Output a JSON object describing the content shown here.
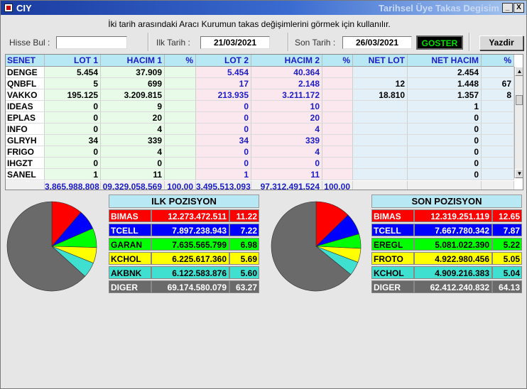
{
  "titlebar": {
    "title": "CIY",
    "subtitle": "Tarihsel Üye Takas Degisim",
    "min_label": "_",
    "close_label": "X"
  },
  "hint": "İki tarih arasındaki  Aracı Kurumun takas değişimlerini görmek için kullanılır.",
  "search": {
    "label": "Hisse Bul :",
    "value": ""
  },
  "first_date": {
    "label": "Ilk Tarih :",
    "value": "21/03/2021"
  },
  "last_date": {
    "label": "Son Tarih :",
    "value": "26/03/2021"
  },
  "buttons": {
    "show": "GOSTER",
    "print": "Yazdir"
  },
  "table": {
    "headers": [
      "SENET",
      "LOT 1",
      "HACIM 1",
      "%",
      "LOT 2",
      "HACIM 2",
      "%",
      "NET LOT",
      "NET HACIM",
      "%"
    ],
    "rows": [
      [
        "DENGE",
        "5.454",
        "37.909",
        "",
        "5.454",
        "40.364",
        "",
        "",
        "2.454",
        ""
      ],
      [
        "QNBFL",
        "5",
        "699",
        "",
        "17",
        "2.148",
        "",
        "12",
        "1.448",
        "67"
      ],
      [
        "VAKKO",
        "195.125",
        "3.209.815",
        "",
        "213.935",
        "3.211.172",
        "",
        "18.810",
        "1.357",
        "8"
      ],
      [
        "IDEAS",
        "0",
        "9",
        "",
        "0",
        "10",
        "",
        "",
        "1",
        ""
      ],
      [
        "EPLAS",
        "0",
        "20",
        "",
        "0",
        "20",
        "",
        "",
        "0",
        ""
      ],
      [
        "INFO",
        "0",
        "4",
        "",
        "0",
        "4",
        "",
        "",
        "0",
        ""
      ],
      [
        "GLRYH",
        "34",
        "339",
        "",
        "34",
        "339",
        "",
        "",
        "0",
        ""
      ],
      [
        "FRIGO",
        "0",
        "4",
        "",
        "0",
        "4",
        "",
        "",
        "0",
        ""
      ],
      [
        "IHGZT",
        "0",
        "0",
        "",
        "0",
        "0",
        "",
        "",
        "0",
        ""
      ],
      [
        "SANEL",
        "1",
        "11",
        "",
        "1",
        "11",
        "",
        "",
        "0",
        ""
      ]
    ],
    "totals": [
      "",
      "3.865.988.808",
      "09.329.058.569",
      "100,00",
      "3.495.513.093",
      "97.312.491.524",
      "100,00",
      "",
      "",
      ""
    ]
  },
  "colors": {
    "red": "#ff0000",
    "blue": "#0000ff",
    "green": "#00ff00",
    "yellow": "#ffff00",
    "cyan": "#40e0d0",
    "gray": "#6a6a6a"
  },
  "first_position": {
    "title": "ILK POZISYON",
    "rows": [
      {
        "name": "BIMAS",
        "value": "12.273.472.511",
        "pct": "11.22",
        "share": 11.22,
        "color": "#ff0000",
        "text": "#ffffff"
      },
      {
        "name": "TCELL",
        "value": "7.897.238.943",
        "pct": "7.22",
        "share": 7.22,
        "color": "#0000ff",
        "text": "#ffffff"
      },
      {
        "name": "GARAN",
        "value": "7.635.565.799",
        "pct": "6.98",
        "share": 6.98,
        "color": "#00ff00",
        "text": "#000000"
      },
      {
        "name": "KCHOL",
        "value": "6.225.617.360",
        "pct": "5.69",
        "share": 5.69,
        "color": "#ffff00",
        "text": "#000000"
      },
      {
        "name": "AKBNK",
        "value": "6.122.583.876",
        "pct": "5.60",
        "share": 5.6,
        "color": "#40e0d0",
        "text": "#000000"
      },
      {
        "name": "DIGER",
        "value": "69.174.580.079",
        "pct": "63.27",
        "share": 63.27,
        "color": "#6a6a6a",
        "text": "#ffffff"
      }
    ]
  },
  "last_position": {
    "title": "SON POZISYON",
    "rows": [
      {
        "name": "BIMAS",
        "value": "12.319.251.119",
        "pct": "12.65",
        "share": 12.65,
        "color": "#ff0000",
        "text": "#ffffff"
      },
      {
        "name": "TCELL",
        "value": "7.667.780.342",
        "pct": "7.87",
        "share": 7.87,
        "color": "#0000ff",
        "text": "#ffffff"
      },
      {
        "name": "EREGL",
        "value": "5.081.022.390",
        "pct": "5.22",
        "share": 5.22,
        "color": "#00ff00",
        "text": "#000000"
      },
      {
        "name": "FROTO",
        "value": "4.922.980.456",
        "pct": "5.05",
        "share": 5.05,
        "color": "#ffff00",
        "text": "#000000"
      },
      {
        "name": "KCHOL",
        "value": "4.909.216.383",
        "pct": "5.04",
        "share": 5.04,
        "color": "#40e0d0",
        "text": "#000000"
      },
      {
        "name": "DIGER",
        "value": "62.412.240.832",
        "pct": "64.13",
        "share": 64.13,
        "color": "#6a6a6a",
        "text": "#ffffff"
      }
    ]
  }
}
